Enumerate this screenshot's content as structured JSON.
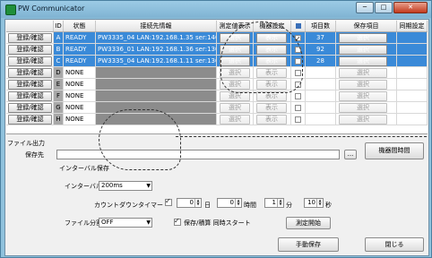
{
  "window": {
    "title": "PW Communicator",
    "controls": [
      "─",
      "□",
      "✕"
    ]
  },
  "table": {
    "headers": [
      "ID",
      "状態",
      "接続先情報",
      "測定値表示",
      "機器設定",
      "",
      "項目数",
      "保存項目",
      "同期設定"
    ],
    "rows": [
      {
        "action": "登録/確認",
        "id": "A",
        "state": "READY",
        "addr": "PW3335_04 LAN:192.168.1.35 ser:1407...",
        "show": "選択",
        "setting": "表示",
        "checked": true,
        "count": "37",
        "save": "選択"
      },
      {
        "action": "登録/確認",
        "id": "B",
        "state": "READY",
        "addr": "PW3336_01 LAN:192.168.1.36 ser:1305...",
        "show": "選択",
        "setting": "表示",
        "checked": false,
        "count": "92",
        "save": "選択"
      },
      {
        "action": "登録/確認",
        "id": "C",
        "state": "READY",
        "addr": "PW3335_04 LAN:192.168.1.11 ser:1305...",
        "show": "選択",
        "setting": "表示",
        "checked": false,
        "count": "28",
        "save": "選択"
      },
      {
        "action": "登録/確認",
        "id": "D",
        "state": "NONE",
        "addr": "",
        "show": "選択",
        "setting": "表示",
        "checked": false,
        "count": "",
        "save": "選択"
      },
      {
        "action": "登録/確認",
        "id": "E",
        "state": "NONE",
        "addr": "",
        "show": "選択",
        "setting": "表示",
        "checked": false,
        "count": "",
        "save": "選択"
      },
      {
        "action": "登録/確認",
        "id": "F",
        "state": "NONE",
        "addr": "",
        "show": "選択",
        "setting": "表示",
        "checked": false,
        "count": "",
        "save": "選択"
      },
      {
        "action": "登録/確認",
        "id": "G",
        "state": "NONE",
        "addr": "",
        "show": "選択",
        "setting": "表示",
        "checked": false,
        "count": "",
        "save": "選択"
      },
      {
        "action": "登録/確認",
        "id": "H",
        "state": "NONE",
        "addr": "",
        "show": "選択",
        "setting": "表示",
        "checked": false,
        "count": "",
        "save": "選択"
      }
    ]
  },
  "file_output": {
    "group_label": "ファイル出力",
    "save_dir_label": "保存先",
    "save_dir_value": "",
    "browse_label": "...",
    "device_time_button": "機器間時間",
    "interval_section": "インターバル保存",
    "interval_label": "インターバル",
    "interval_value": "200ms",
    "countdown_label": "カウントダウンタイマー",
    "countdown_checked": true,
    "days_value": "0",
    "days_unit": "日",
    "hours_value": "0",
    "hours_unit": "時間",
    "minutes_value": "1",
    "minutes_unit": "分",
    "seconds_value": "10",
    "seconds_unit": "秒",
    "split_label": "ファイル分割",
    "split_value": "OFF",
    "sync_start_label": "保存/積算 同時スタート",
    "sync_start_checked": true,
    "start_measure_button": "測定開始",
    "manual_save_button": "手動保存",
    "close_button": "閉じる"
  },
  "colors": {
    "titlebar": "#8fc1dc",
    "selected_row": "#3a8ad8",
    "address_fill": "#8c8c8c",
    "id_fill": "#a8a8a8"
  }
}
